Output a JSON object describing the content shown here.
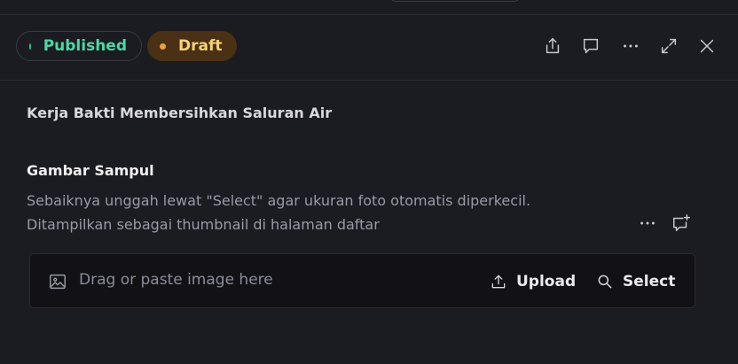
{
  "header": {
    "status_published": "Published",
    "status_draft": "Draft",
    "icons": [
      "share-icon",
      "comment-icon",
      "more-icon",
      "expand-icon",
      "close-icon"
    ]
  },
  "content": {
    "title": "Kerja Bakti Membersihkan Saluran Air",
    "cover": {
      "label": "Gambar Sampul",
      "description_line1": "Sebaiknya unggah lewat \"Select\" agar ukuran foto otomatis diperkecil.",
      "description_line2": "Ditampilkan sebagai thumbnail di halaman daftar",
      "dropzone_placeholder": "Drag or paste image here",
      "upload_label": "Upload",
      "select_label": "Select"
    }
  },
  "colors": {
    "background": "#1b1b22",
    "published": "#4fd6a4",
    "draft_bg": "#4a3014",
    "draft_text": "#f3d27a"
  }
}
